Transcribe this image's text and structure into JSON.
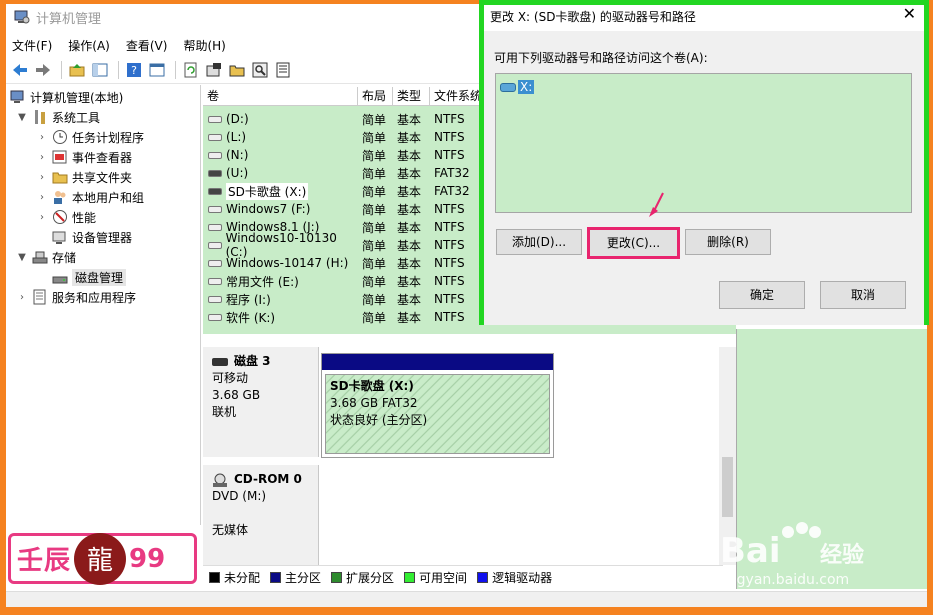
{
  "window": {
    "title": "计算机管理"
  },
  "menu": [
    "文件(F)",
    "操作(A)",
    "查看(V)",
    "帮助(H)"
  ],
  "toolbar_icons": [
    "back-icon",
    "forward-icon",
    "up-folder-icon",
    "show-hide-tree-icon",
    "help-icon",
    "properties-icon",
    "refresh-icon",
    "settings-icon",
    "open-folder-icon",
    "search-icon",
    "export-icon"
  ],
  "tree": [
    {
      "label": "计算机管理(本地)",
      "icon": "computer-management-icon",
      "expander": ""
    },
    {
      "label": "系统工具",
      "icon": "tools-icon",
      "expander": "▼"
    },
    {
      "label": "任务计划程序",
      "icon": "clock-icon",
      "expander": "›"
    },
    {
      "label": "事件查看器",
      "icon": "event-viewer-icon",
      "expander": "›"
    },
    {
      "label": "共享文件夹",
      "icon": "shared-folder-icon",
      "expander": "›"
    },
    {
      "label": "本地用户和组",
      "icon": "users-icon",
      "expander": "›"
    },
    {
      "label": "性能",
      "icon": "performance-icon",
      "expander": "›"
    },
    {
      "label": "设备管理器",
      "icon": "device-manager-icon",
      "expander": ""
    },
    {
      "label": "存储",
      "icon": "storage-icon",
      "expander": "▼"
    },
    {
      "label": "磁盘管理",
      "icon": "disk-management-icon",
      "expander": ""
    },
    {
      "label": "服务和应用程序",
      "icon": "services-icon",
      "expander": "›"
    }
  ],
  "volumes": {
    "headers": [
      "卷",
      "布局",
      "类型",
      "文件系统"
    ],
    "rows": [
      [
        "(D:)",
        "简单",
        "基本",
        "NTFS"
      ],
      [
        "(L:)",
        "简单",
        "基本",
        "NTFS"
      ],
      [
        "(N:)",
        "简单",
        "基本",
        "NTFS"
      ],
      [
        "(U:)",
        "简单",
        "基本",
        "FAT32"
      ],
      [
        "SD卡歌盘 (X:)",
        "简单",
        "基本",
        "FAT32"
      ],
      [
        "Windows7 (F:)",
        "简单",
        "基本",
        "NTFS"
      ],
      [
        "Windows8.1 (J:)",
        "简单",
        "基本",
        "NTFS"
      ],
      [
        "Windows10-10130 (C:)",
        "简单",
        "基本",
        "NTFS"
      ],
      [
        "Windows-10147 (H:)",
        "简单",
        "基本",
        "NTFS"
      ],
      [
        "常用文件 (E:)",
        "简单",
        "基本",
        "NTFS"
      ],
      [
        "程序 (I:)",
        "简单",
        "基本",
        "NTFS"
      ],
      [
        "软件 (K:)",
        "简单",
        "基本",
        "NTFS"
      ]
    ]
  },
  "disk3": {
    "name": "磁盘 3",
    "type": "可移动",
    "size": "3.68 GB",
    "status": "联机",
    "partition": {
      "name": "SD卡歌盘  (X:)",
      "size": "3.68 GB FAT32",
      "status": "状态良好 (主分区)"
    }
  },
  "cdrom": {
    "name": "CD-ROM 0",
    "drive": "DVD (M:)",
    "status": "无媒体"
  },
  "legend": [
    {
      "label": "未分配",
      "color": "#000000"
    },
    {
      "label": "主分区",
      "color": "#0a0a84"
    },
    {
      "label": "扩展分区",
      "color": "#2e8b2e"
    },
    {
      "label": "可用空间",
      "color": "#33ee33"
    },
    {
      "label": "逻辑驱动器",
      "color": "#1010ee"
    }
  ],
  "dialog": {
    "title": "更改 X: (SD卡歌盘) 的驱动器号和路径",
    "close": "✕",
    "prompt": "可用下列驱动器号和路径访问这个卷(A):",
    "item": "X:",
    "buttons": {
      "add": "添加(D)...",
      "change": "更改(C)...",
      "remove": "删除(R)",
      "ok": "确定",
      "cancel": "取消"
    }
  },
  "watermark": {
    "brand_left": "壬辰",
    "brand_right": "99"
  },
  "colors": {
    "frame": "#f58220",
    "dialog_border": "#22d622",
    "highlight": "#e8246e",
    "selection_green": "#c8ecc8"
  }
}
